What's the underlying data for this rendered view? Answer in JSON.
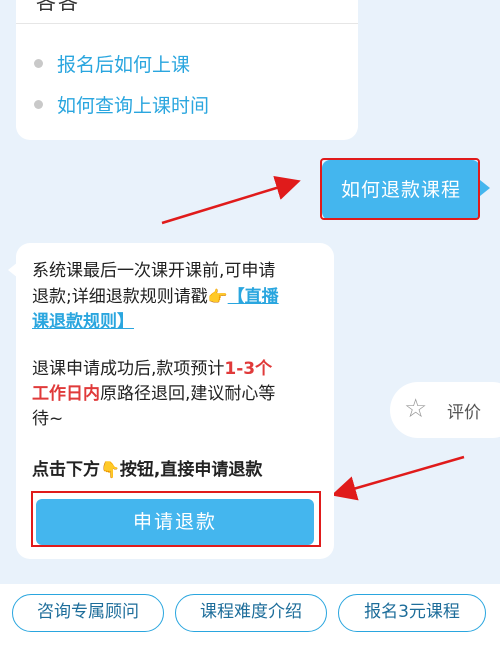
{
  "top_card": {
    "cut_text": "各各",
    "questions": [
      "报名后如何上课",
      "如何查询上课时间"
    ]
  },
  "user_message": "如何退款课程",
  "bot_message": {
    "p1_line1": "系统课最后一次课开课前,可申请",
    "p1_line2": "退款;详细退款规则请戳",
    "p1_link_line1": "【直播",
    "p1_link_line2": "课退款规则】",
    "p2_line1": "退课申请成功后,款项预计",
    "p2_red1": "1-3个",
    "p2_red2": "工作日内",
    "p2_line2": "原路径退回,建议耐心等",
    "p2_line3": "待~",
    "p3": "点击下方",
    "p3_tail": "按钮,直接申请退款",
    "button": "申请退款"
  },
  "rate": {
    "icon": "star-outline-icon",
    "label": "评价"
  },
  "bottom_chips": [
    "咨询专属顾问",
    "课程难度介绍",
    "报名3元课程"
  ],
  "colors": {
    "accent": "#44b6ee",
    "link": "#2aa6df",
    "highlight_red": "#e01b1b",
    "background": "#e9f2fb"
  }
}
